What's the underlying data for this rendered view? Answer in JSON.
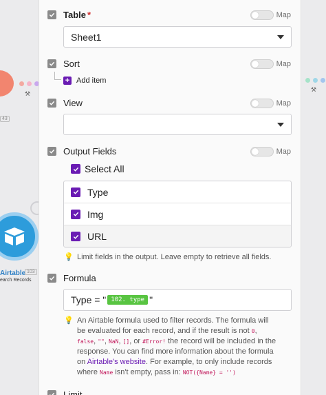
{
  "canvas": {
    "left_badge": "43",
    "airtable_node": {
      "label": "Airtable",
      "count": "103",
      "subtitle": "earch Records"
    }
  },
  "fields": {
    "table": {
      "label": "Table",
      "required_mark": "*",
      "map_label": "Map",
      "value": "Sheet1"
    },
    "sort": {
      "label": "Sort",
      "map_label": "Map",
      "add_item_label": "Add item"
    },
    "view": {
      "label": "View",
      "map_label": "Map",
      "value": ""
    },
    "output_fields": {
      "label": "Output Fields",
      "map_label": "Map",
      "select_all_label": "Select All",
      "items": [
        {
          "label": "Type"
        },
        {
          "label": "Img"
        },
        {
          "label": "URL"
        }
      ],
      "hint": "Limit fields in the output. Leave empty to retrieve all fields."
    },
    "formula": {
      "label": "Formula",
      "prefix": "Type = \"",
      "pill": "102. type",
      "suffix": "\"",
      "hint": {
        "line1": "An Airtable formula used to filter records. The formula will be",
        "line2": "evaluated for each record, and if the result is not",
        "code_zero": "0",
        "code_false": "false",
        "code_empty": "\"\"",
        "code_nan": "NaN",
        "code_array": "[]",
        "or_text": ", or",
        "code_error": "#Error!",
        "line3_rest": "the record will be included in the response. You can",
        "line4": "find more information about the formula on",
        "link": "Airtable's website",
        "line5": "For example, to only include records where",
        "code_name": "Name",
        "line5_rest": "isn't empty,",
        "line6": "pass in:",
        "code_example": "NOT({Name} = '')"
      }
    },
    "limit": {
      "label": "Limit"
    }
  },
  "colors": {
    "accent": "#6a1bb3",
    "airtable_blue": "#2d9cdb",
    "pill_green": "#58c441",
    "code_pink": "#c2185b"
  }
}
